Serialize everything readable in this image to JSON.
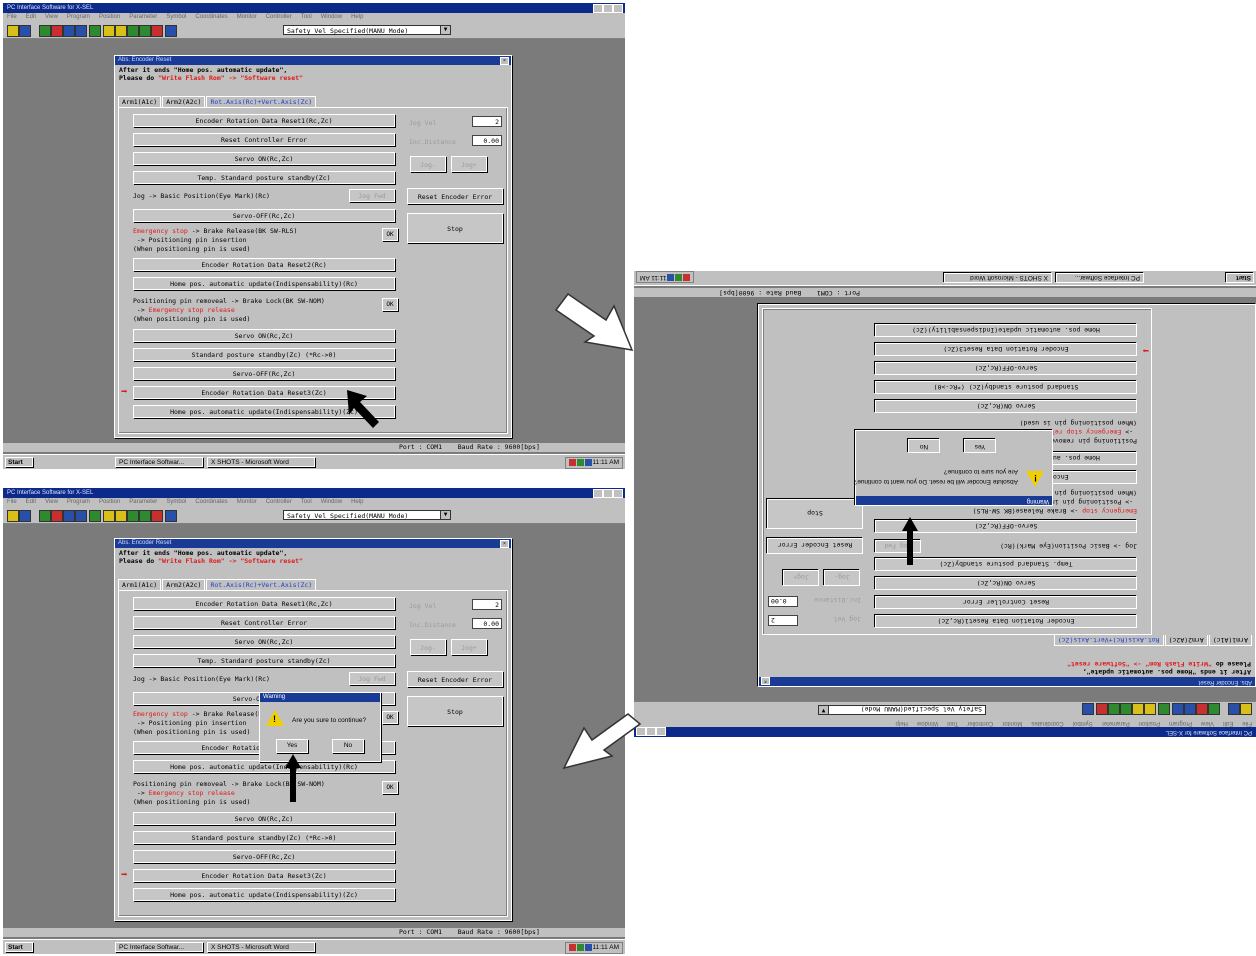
{
  "app": {
    "window_title": "PC Interface Software for X-SEL",
    "menu": [
      "File",
      "Edit",
      "View",
      "Program",
      "Position",
      "Parameter",
      "Symbol",
      "Coordinates",
      "Monitor",
      "Controller",
      "Tool",
      "Window",
      "Help"
    ],
    "mode_combo": "Safety Vel Specified(MANU Mode)"
  },
  "dialog": {
    "title": "Abs. Encoder Reset",
    "notice_line1": "After it ends \"Home pos. automatic update\",",
    "notice_prefix": "Please do ",
    "notice_red1": "\"Write Flash Rom\" -> \"Software reset\"",
    "tabs": [
      "Arm1(A1c)",
      "Arm2(A2c)",
      "Rot.Axis(Rc)+Vert.Axis(Zc)"
    ],
    "buttons": {
      "encoder_reset1": "Encoder Rotation Data Reset1(Rc,Zc)",
      "reset_ctrl_error": "Reset Controller Error",
      "servo_on1": "Servo ON(Rc,Zc)",
      "temp_standby": "Temp. Standard posture standby(Zc)",
      "servo_off1": "Servo-OFF(Rc,Zc)",
      "encoder_reset2": "Encoder Rotation Data Reset2(Rc)",
      "home_update1": "Home pos. automatic update(Indispensability)(Rc)",
      "servo_on2": "Servo ON(Rc,Zc)",
      "standard_standby": "Standard posture standby(Zc) (*Rc->0)",
      "servo_off2": "Servo-OFF(Rc,Zc)",
      "encoder_reset3": "Encoder Rotation Data Reset3(Zc)",
      "home_update2": "Home pos. automatic update(Indispensability)(Zc)",
      "jog_fwd": "Jog Fwd",
      "reset_encoder_error": "Reset Encoder Error",
      "stop": "Stop",
      "ok": "OK",
      "jog_minus": "Jog-",
      "jog_plus": "Jog+"
    },
    "labels": {
      "jog_basic": "Jog -> Basic Position(Eye Mark)(Rc)",
      "brake_release_red": "Emergency stop",
      "brake_release_rest": " -> Brake Release(BK SW-RLS)",
      "pin_insert": " -> Positioning pin insertion",
      "when_pin": "(When positioning pin is used)",
      "pin_removal": "Positioning pin removeal -> Brake Lock(BK SW-NOM)",
      "arrow_prefix": " -> ",
      "estop_release_red": "Emergency stop release",
      "when_pin2": "(When positioning pin is used)",
      "jog_vel": "Jog Vel",
      "inc_distance": "Inc.Distance"
    },
    "fields": {
      "jog_vel": "2",
      "inc_distance": "0.00"
    }
  },
  "status_bar": "Port : COM1    Baud Rate : 9600[bps]",
  "taskbar": {
    "start": "Start",
    "task1": "PC Interface Softwar...",
    "task2": "X SHOTS - Microsoft Word",
    "clock": "11:11 AM"
  },
  "warning": {
    "title": "Warning",
    "message": "Are you sure to continue?",
    "message_alt": "Absolute Encoder will be reset. Do you want to continue?",
    "yes": "Yes",
    "no": "No"
  },
  "colors": {
    "title_blue": "#1a3b95",
    "arrow_red": "#e01818",
    "face": "#c0c0c0",
    "desktop": "#7b7b7b"
  }
}
